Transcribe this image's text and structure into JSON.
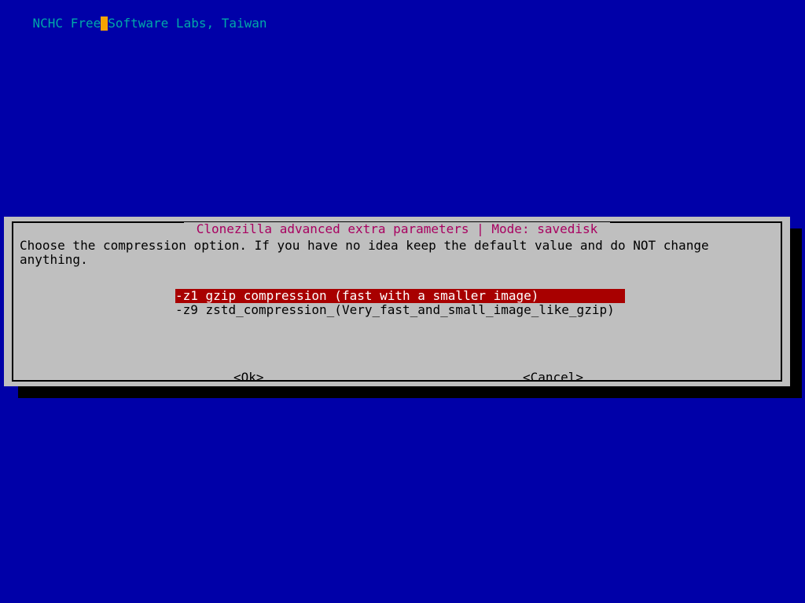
{
  "header": {
    "seg1": "NCHC Free",
    "seg2": "Software Labs, Taiwan"
  },
  "dialog": {
    "title": " Clonezilla advanced extra parameters | Mode: savedisk ",
    "instruction": "Choose the compression option. If you have no idea keep the default value and do NOT change anything.",
    "options": [
      {
        "flag": "-z1",
        "label": "gzip compression (fast with a smaller image)",
        "selected": true
      },
      {
        "flag": "-z9",
        "label": "zstd_compression_(Very_fast_and_small_image_like_gzip)",
        "selected": false
      }
    ],
    "buttons": {
      "ok": "<Ok>",
      "cancel": "<Cancel>"
    }
  }
}
